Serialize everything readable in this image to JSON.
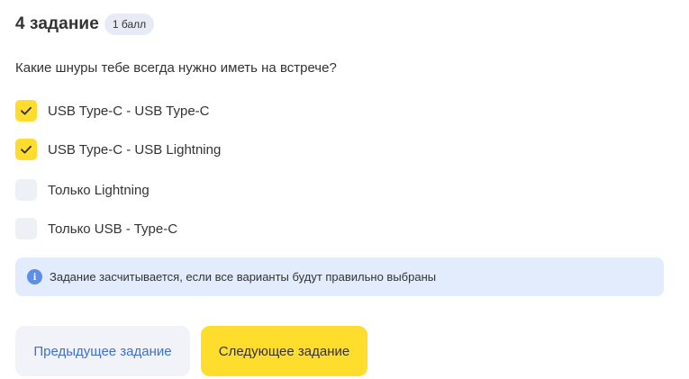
{
  "task": {
    "title": "4 задание",
    "badge": "1 балл"
  },
  "question": "Какие шнуры тебе всегда нужно иметь на встрече?",
  "options": [
    {
      "label": "USB Type-C - USB Type-C",
      "checked": true
    },
    {
      "label": "USB Type-C - USB Lightning",
      "checked": true
    },
    {
      "label": "Только Lightning",
      "checked": false
    },
    {
      "label": "Только USB - Type-C",
      "checked": false
    }
  ],
  "info": {
    "icon": "info-icon",
    "text": "Задание засчитывается, если все варианты будут правильно выбраны"
  },
  "buttons": {
    "prev": "Предыдущее задание",
    "next": "Следующее задание"
  },
  "colors": {
    "accent_yellow": "#ffdd2d",
    "checkbox_empty": "#edf0f5",
    "info_bg": "#e3ecfc",
    "info_icon": "#5b8fe8",
    "link_blue": "#3d6fd9",
    "secondary_button_bg": "#f1f3f8"
  }
}
